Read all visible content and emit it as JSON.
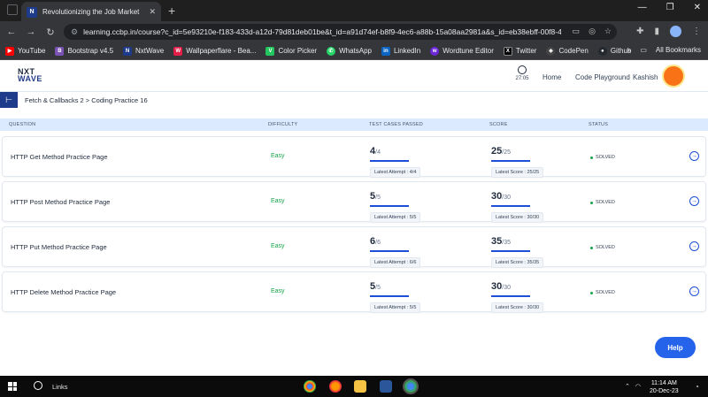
{
  "browser": {
    "tab_title": "Revolutionizing the Job Market",
    "url": "learning.ccbp.in/course?c_id=5e93210e-f183-433d-a12d-79d81deb01be&t_id=a91d74ef-b8f9-4ec6-a88b-15a08aa2981a&s_id=eb38ebff-00f8-43af-...",
    "bookmarks": [
      {
        "label": "YouTube",
        "color": "#ff0000"
      },
      {
        "label": "Bootstrap v4.5",
        "color": "#7952b3"
      },
      {
        "label": "NxtWave",
        "color": "#1e3a8a"
      },
      {
        "label": "Wallpaperflare - Bea...",
        "color": "#e11d48"
      },
      {
        "label": "Color Picker",
        "color": "#22c55e"
      },
      {
        "label": "WhatsApp",
        "color": "#25d366"
      },
      {
        "label": "LinkedIn",
        "color": "#0a66c2"
      },
      {
        "label": "Wordtune Editor",
        "color": "#6d28d9"
      },
      {
        "label": "Twitter",
        "color": "#000000"
      },
      {
        "label": "CodePen",
        "color": "#444444"
      },
      {
        "label": "Github",
        "color": "#24292f"
      }
    ],
    "all_bookmarks": "All Bookmarks"
  },
  "header": {
    "logo_line1": "NXT",
    "logo_line2": "WAVE",
    "timer": "27:05",
    "nav": [
      "Home",
      "Code Playground",
      "Kashish"
    ]
  },
  "breadcrumb": "Fetch & Callbacks 2 > Coding Practice 16",
  "table": {
    "columns": [
      "QUESTION",
      "DIFFICULTY",
      "TEST CASES PASSED",
      "SCORE",
      "STATUS"
    ],
    "rows": [
      {
        "question": "HTTP Get Method Practice Page",
        "difficulty": "Easy",
        "tc": "4",
        "tc_total": "/4",
        "tc_attempt": "Latest Attempt : 4/4",
        "score": "25",
        "score_total": "/25",
        "score_attempt": "Latest Score : 25/25",
        "status": "SOLVED"
      },
      {
        "question": "HTTP Post Method Practice Page",
        "difficulty": "Easy",
        "tc": "5",
        "tc_total": "/5",
        "tc_attempt": "Latest Attempt : 5/5",
        "score": "30",
        "score_total": "/30",
        "score_attempt": "Latest Score : 30/30",
        "status": "SOLVED"
      },
      {
        "question": "HTTP Put Method Practice Page",
        "difficulty": "Easy",
        "tc": "6",
        "tc_total": "/6",
        "tc_attempt": "Latest Attempt : 6/6",
        "score": "35",
        "score_total": "/35",
        "score_attempt": "Latest Score : 35/35",
        "status": "SOLVED"
      },
      {
        "question": "HTTP Delete Method Practice Page",
        "difficulty": "Easy",
        "tc": "5",
        "tc_total": "/5",
        "tc_attempt": "Latest Attempt : 5/5",
        "score": "30",
        "score_total": "/30",
        "score_attempt": "Latest Score : 30/30",
        "status": "SOLVED"
      }
    ]
  },
  "help": "Help",
  "taskbar": {
    "search": "Links",
    "time": "11:14 AM",
    "date": "20-Dec-23"
  }
}
